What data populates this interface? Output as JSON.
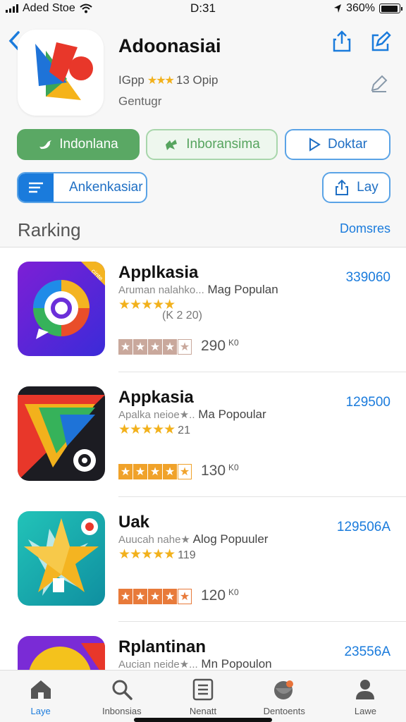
{
  "status": {
    "carrier": "Aded Stoe",
    "time": "D:31",
    "battery_text": "360%",
    "battery_level": 0.95
  },
  "header": {
    "app_name": "Adoonasiai",
    "meta_left": "IGpp",
    "meta_rating_text": "13 Opip",
    "subtitle": "Gentugr"
  },
  "chips": {
    "green": "Indonlana",
    "lightgreen": "Inboransima",
    "blue_outline": "Doktar",
    "blue2": "Ankenkasiar",
    "lay": "Lay"
  },
  "section": {
    "title": "Rarking",
    "link": "Domsres"
  },
  "apps": [
    {
      "name": "Applkasia",
      "desc": "Aruman nalahko...",
      "tag": "Mag Populan",
      "stars": "★★★★★",
      "star_count": "",
      "sub_count": "(K 2 20)",
      "downloads": "290",
      "downloads_unit": "K0",
      "price": "339060",
      "ribbon": "cinte"
    },
    {
      "name": "Appkasia",
      "desc": "Apalka neioe★..",
      "tag": "Ma Popoular",
      "stars": "★★★★★",
      "star_count": "21",
      "sub_count": "",
      "downloads": "130",
      "downloads_unit": "K0",
      "price": "129500"
    },
    {
      "name": "Uak",
      "desc": "Auucah nahe★",
      "tag": "Alog Popuuler",
      "stars": "★★★★★",
      "star_count": "119",
      "sub_count": "",
      "downloads": "120",
      "downloads_unit": "K0",
      "price": "129506A"
    },
    {
      "name": "Rplantinan",
      "desc": "Aucian neide★...",
      "tag": "Mn Popoulon",
      "stars": "★★★★★",
      "star_count": "",
      "sub_count": "",
      "downloads": "",
      "downloads_unit": "",
      "price": "23556A"
    }
  ],
  "tabs": [
    {
      "label": "Laye",
      "icon": "home-icon",
      "active": true
    },
    {
      "label": "Inbonsias",
      "icon": "search-icon",
      "active": false
    },
    {
      "label": "Nenatt",
      "icon": "news-icon",
      "active": false
    },
    {
      "label": "Dentoents",
      "icon": "games-icon",
      "active": false
    },
    {
      "label": "Lawe",
      "icon": "person-icon",
      "active": false
    }
  ],
  "colors": {
    "accent": "#1a7bdc",
    "green": "#5aa864",
    "star": "#f2b11c"
  }
}
